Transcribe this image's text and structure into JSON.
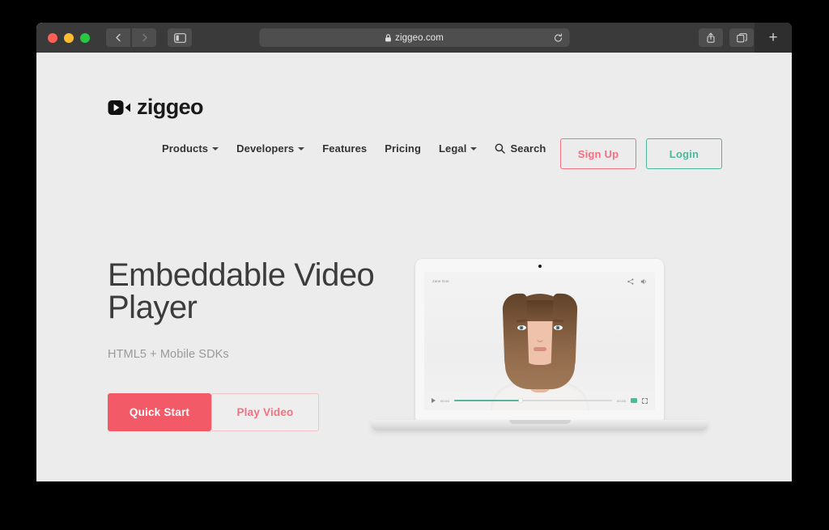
{
  "browser": {
    "url": "ziggeo.com",
    "lock_icon": "lock-icon",
    "reload_icon": "reload-icon",
    "back_icon": "chevron-left-icon",
    "forward_icon": "chevron-right-icon",
    "sidebar_icon": "sidebar-toggle-icon",
    "share_icon": "share-icon",
    "tabs_icon": "tab-overview-icon",
    "new_tab_label": "+"
  },
  "site": {
    "logo_text": "ziggeo",
    "logo_icon": "video-camera-play-icon"
  },
  "nav": {
    "items": [
      {
        "label": "Products",
        "has_caret": true
      },
      {
        "label": "Developers",
        "has_caret": true
      },
      {
        "label": "Features",
        "has_caret": false
      },
      {
        "label": "Pricing",
        "has_caret": false
      },
      {
        "label": "Legal",
        "has_caret": true
      }
    ],
    "search_label": "Search",
    "search_icon": "search-icon",
    "sign_up_label": "Sign Up",
    "login_label": "Login"
  },
  "hero": {
    "title_line1": "Embeddable Video",
    "title_line2": "Player",
    "subtitle": "HTML5 + Mobile SDKs",
    "cta_primary": "Quick Start",
    "cta_secondary": "Play Video"
  },
  "video_player": {
    "name_label": "Jane Doe",
    "current_time": "00:00",
    "duration": "00:35",
    "share_icon": "share-icon",
    "volume_icon": "volume-icon",
    "play_icon": "play-icon",
    "cc_icon": "closed-caption-icon",
    "fullscreen_icon": "fullscreen-icon",
    "progress_percent": 42
  },
  "colors": {
    "coral": "#f15a66",
    "coral_light": "#f4717f",
    "teal": "#4cb89a",
    "player_teal": "#56b69b",
    "page_bg": "#ececec",
    "toolbar_bg": "#3a3a3a",
    "heading": "#3c3c3c"
  }
}
